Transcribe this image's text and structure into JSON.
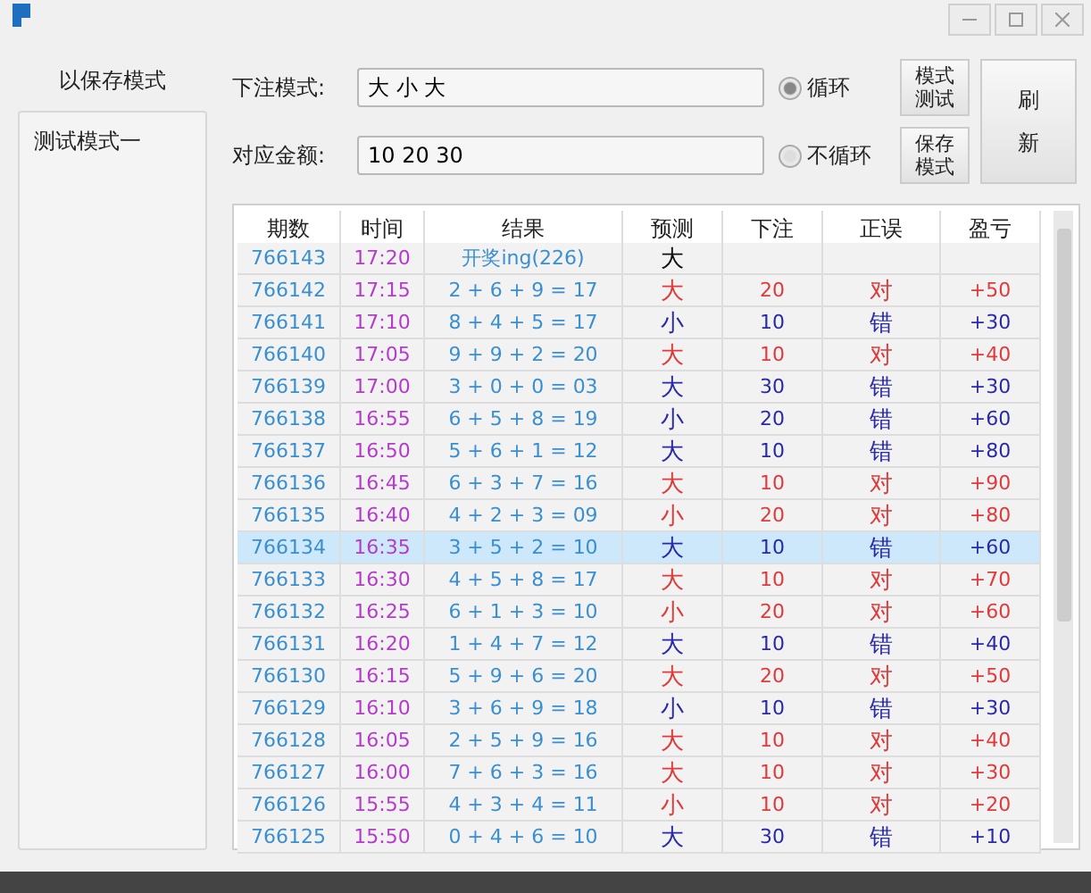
{
  "saved_modes": {
    "label": "以保存模式",
    "items": [
      {
        "label": "测试模式一",
        "selected": false
      }
    ]
  },
  "form": {
    "fields": [
      {
        "label": "下注模式:",
        "value": "大 小 大"
      },
      {
        "label": "对应金额:",
        "value": "10 20 30"
      }
    ],
    "radios": [
      {
        "label": "循环",
        "selected": true
      },
      {
        "label": "不循环",
        "selected": false
      }
    ],
    "buttons": [
      "模式测试",
      "保存模式"
    ],
    "refresh": "刷新"
  },
  "table": {
    "columns": [
      "期数",
      "时间",
      "结果",
      "预测",
      "下注",
      "正误",
      "盈亏"
    ],
    "rows": [
      {
        "issue": "766143",
        "time": "17:20",
        "result": "开奖ing(226)",
        "prediction": "大",
        "kind": "pending",
        "selected": false
      },
      {
        "issue": "766142",
        "time": "17:15",
        "result": "2 + 6 + 9 = 17",
        "prediction": "大",
        "bet": "20",
        "verdict": "对",
        "profit": "+50",
        "kind": "correct",
        "selected": false
      },
      {
        "issue": "766141",
        "time": "17:10",
        "result": "8 + 4 + 5 = 17",
        "prediction": "小",
        "bet": "10",
        "verdict": "错",
        "profit": "+30",
        "kind": "wrong",
        "selected": false
      },
      {
        "issue": "766140",
        "time": "17:05",
        "result": "9 + 9 + 2 = 20",
        "prediction": "大",
        "bet": "10",
        "verdict": "对",
        "profit": "+40",
        "kind": "correct",
        "selected": false
      },
      {
        "issue": "766139",
        "time": "17:00",
        "result": "3 + 0 + 0 = 03",
        "prediction": "大",
        "bet": "30",
        "verdict": "错",
        "profit": "+30",
        "kind": "wrong",
        "selected": false
      },
      {
        "issue": "766138",
        "time": "16:55",
        "result": "6 + 5 + 8 = 19",
        "prediction": "小",
        "bet": "20",
        "verdict": "错",
        "profit": "+60",
        "kind": "wrong",
        "selected": false
      },
      {
        "issue": "766137",
        "time": "16:50",
        "result": "5 + 6 + 1 = 12",
        "prediction": "大",
        "bet": "10",
        "verdict": "错",
        "profit": "+80",
        "kind": "wrong",
        "selected": false
      },
      {
        "issue": "766136",
        "time": "16:45",
        "result": "6 + 3 + 7 = 16",
        "prediction": "大",
        "bet": "10",
        "verdict": "对",
        "profit": "+90",
        "kind": "correct",
        "selected": false
      },
      {
        "issue": "766135",
        "time": "16:40",
        "result": "4 + 2 + 3 = 09",
        "prediction": "小",
        "bet": "20",
        "verdict": "对",
        "profit": "+80",
        "kind": "correct",
        "selected": false
      },
      {
        "issue": "766134",
        "time": "16:35",
        "result": "3 + 5 + 2 = 10",
        "prediction": "大",
        "bet": "10",
        "verdict": "错",
        "profit": "+60",
        "kind": "wrong",
        "selected": true
      },
      {
        "issue": "766133",
        "time": "16:30",
        "result": "4 + 5 + 8 = 17",
        "prediction": "大",
        "bet": "10",
        "verdict": "对",
        "profit": "+70",
        "kind": "correct",
        "selected": false
      },
      {
        "issue": "766132",
        "time": "16:25",
        "result": "6 + 1 + 3 = 10",
        "prediction": "小",
        "bet": "20",
        "verdict": "对",
        "profit": "+60",
        "kind": "correct",
        "selected": false
      },
      {
        "issue": "766131",
        "time": "16:20",
        "result": "1 + 4 + 7 = 12",
        "prediction": "大",
        "bet": "10",
        "verdict": "错",
        "profit": "+40",
        "kind": "wrong",
        "selected": false
      },
      {
        "issue": "766130",
        "time": "16:15",
        "result": "5 + 9 + 6 = 20",
        "prediction": "大",
        "bet": "20",
        "verdict": "对",
        "profit": "+50",
        "kind": "correct",
        "selected": false
      },
      {
        "issue": "766129",
        "time": "16:10",
        "result": "3 + 6 + 9 = 18",
        "prediction": "小",
        "bet": "10",
        "verdict": "错",
        "profit": "+30",
        "kind": "wrong",
        "selected": false
      },
      {
        "issue": "766128",
        "time": "16:05",
        "result": "2 + 5 + 9 = 16",
        "prediction": "大",
        "bet": "10",
        "verdict": "对",
        "profit": "+40",
        "kind": "correct",
        "selected": false
      },
      {
        "issue": "766127",
        "time": "16:00",
        "result": "7 + 6 + 3 = 16",
        "prediction": "大",
        "bet": "10",
        "verdict": "对",
        "profit": "+30",
        "kind": "correct",
        "selected": false
      },
      {
        "issue": "766126",
        "time": "15:55",
        "result": "4 + 3 + 4 = 11",
        "prediction": "小",
        "bet": "10",
        "verdict": "对",
        "profit": "+20",
        "kind": "correct",
        "selected": false
      },
      {
        "issue": "766125",
        "time": "15:50",
        "result": "0 + 4 + 6 = 10",
        "prediction": "大",
        "bet": "30",
        "verdict": "错",
        "profit": "+10",
        "kind": "wrong",
        "selected": false
      }
    ]
  }
}
